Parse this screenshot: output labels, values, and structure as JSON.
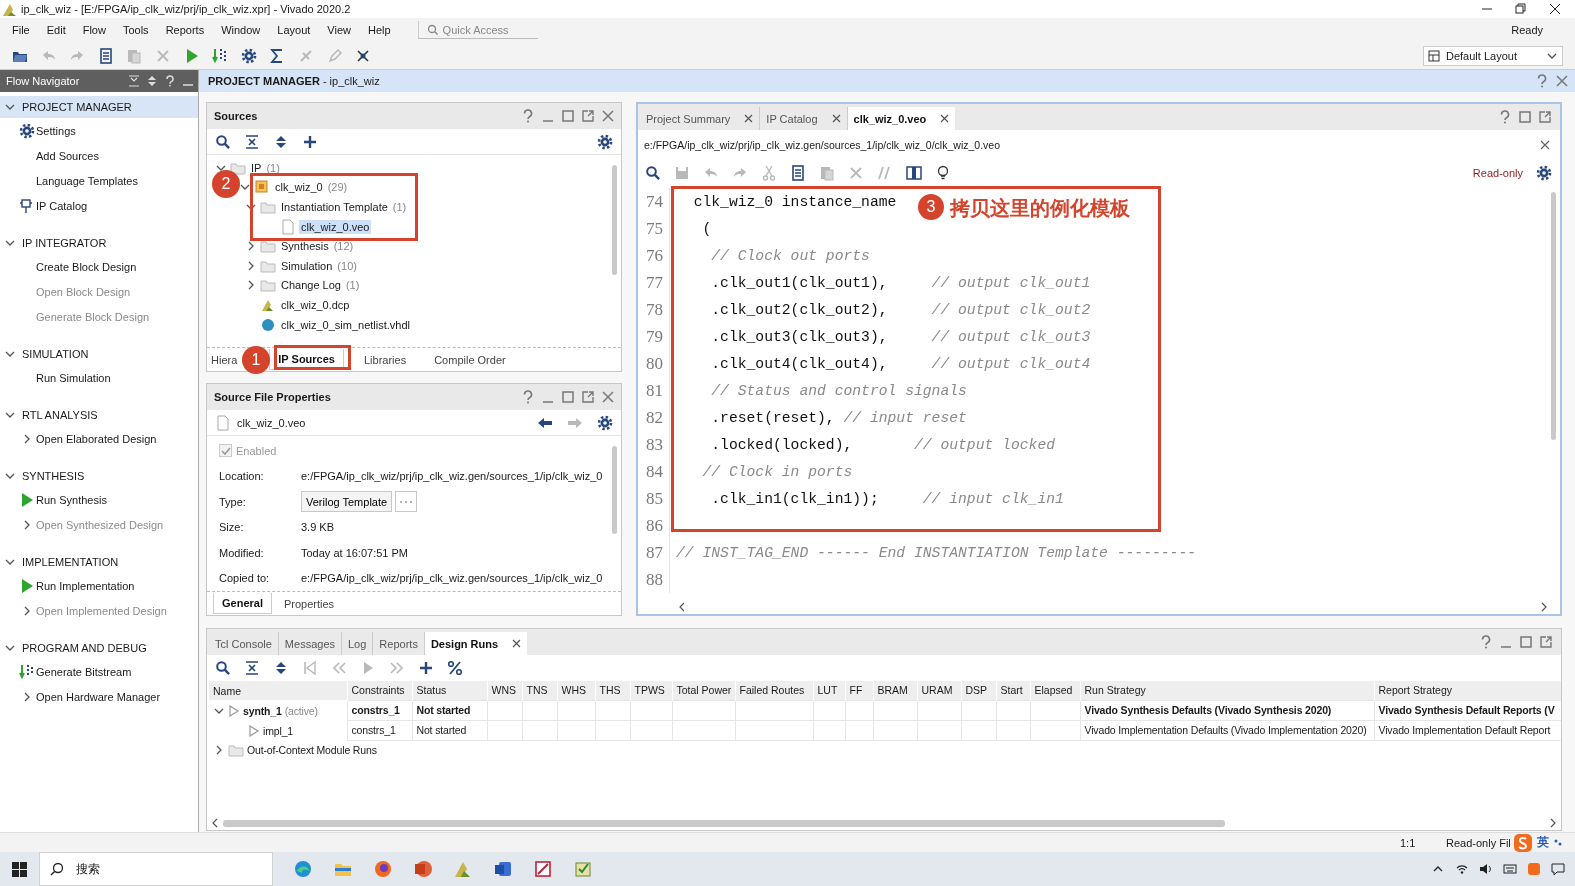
{
  "window": {
    "title": "ip_clk_wiz - [E:/FPGA/ip_clk_wiz/prj/ip_clk_wiz.xpr] - Vivado 2020.2"
  },
  "menu": [
    "File",
    "Edit",
    "Flow",
    "Tools",
    "Reports",
    "Window",
    "Layout",
    "View",
    "Help"
  ],
  "quick_access": {
    "placeholder": "Quick Access"
  },
  "status_text": "Ready",
  "layout_dropdown": {
    "value": "Default Layout"
  },
  "flow_navigator": {
    "title": "Flow Navigator",
    "sections": [
      {
        "title": "PROJECT MANAGER",
        "selected": true,
        "expanded": true,
        "items": [
          {
            "label": "Settings",
            "kind": "gear",
            "disabled": false
          },
          {
            "label": "Add Sources",
            "kind": "plain",
            "disabled": false
          },
          {
            "label": "Language Templates",
            "kind": "plain",
            "disabled": false
          },
          {
            "label": "IP Catalog",
            "kind": "ip",
            "disabled": false
          }
        ]
      },
      {
        "title": "IP INTEGRATOR",
        "selected": false,
        "expanded": true,
        "items": [
          {
            "label": "Create Block Design",
            "kind": "plain",
            "disabled": false
          },
          {
            "label": "Open Block Design",
            "kind": "plain",
            "disabled": true
          },
          {
            "label": "Generate Block Design",
            "kind": "plain",
            "disabled": true
          }
        ]
      },
      {
        "title": "SIMULATION",
        "selected": false,
        "expanded": true,
        "items": [
          {
            "label": "Run Simulation",
            "kind": "plain",
            "disabled": false
          }
        ]
      },
      {
        "title": "RTL ANALYSIS",
        "selected": false,
        "expanded": true,
        "items": [
          {
            "label": "Open Elaborated Design",
            "kind": "expand",
            "disabled": false
          }
        ]
      },
      {
        "title": "SYNTHESIS",
        "selected": false,
        "expanded": true,
        "items": [
          {
            "label": "Run Synthesis",
            "kind": "run",
            "disabled": false
          },
          {
            "label": "Open Synthesized Design",
            "kind": "expand",
            "disabled": true
          }
        ]
      },
      {
        "title": "IMPLEMENTATION",
        "selected": false,
        "expanded": true,
        "items": [
          {
            "label": "Run Implementation",
            "kind": "run",
            "disabled": false
          },
          {
            "label": "Open Implemented Design",
            "kind": "expand",
            "disabled": true
          }
        ]
      },
      {
        "title": "PROGRAM AND DEBUG",
        "selected": false,
        "expanded": true,
        "items": [
          {
            "label": "Generate Bitstream",
            "kind": "bitstream",
            "disabled": false
          },
          {
            "label": "Open Hardware Manager",
            "kind": "expand",
            "disabled": false
          }
        ]
      }
    ]
  },
  "project_bar": {
    "title": "**PROJECT MANAGER** - ip_clk_wiz"
  },
  "sources": {
    "title": "Sources",
    "tree": [
      {
        "label": "IP",
        "count": "(1)",
        "kind": "folder",
        "expanded": true,
        "selected": false,
        "children": [
          {
            "label": "clk_wiz_0",
            "count": "(29)",
            "kind": "ip",
            "expanded": true,
            "selected": false,
            "children": [
              {
                "label": "Instantiation Template",
                "count": "(1)",
                "kind": "folder",
                "expanded": true,
                "selected": false,
                "children": [
                  {
                    "label": "clk_wiz_0.veo",
                    "kind": "file",
                    "selected": true
                  }
                ]
              },
              {
                "label": "Synthesis",
                "count": "(12)",
                "kind": "folder",
                "expanded": false,
                "selected": false
              },
              {
                "label": "Simulation",
                "count": "(10)",
                "kind": "folder",
                "expanded": false,
                "selected": false
              },
              {
                "label": "Change Log",
                "count": "(1)",
                "kind": "folder",
                "expanded": false,
                "selected": false
              },
              {
                "label": "clk_wiz_0.dcp",
                "kind": "dcp",
                "selected": false
              },
              {
                "label": "clk_wiz_0_sim_netlist.vhdl",
                "kind": "sim",
                "selected": false
              }
            ]
          }
        ]
      }
    ],
    "tabs": [
      {
        "label": "Hiera",
        "selected": false
      },
      {
        "label": "IP Sources",
        "selected": true
      },
      {
        "label": "Libraries",
        "selected": false
      },
      {
        "label": "Compile Order",
        "selected": false
      }
    ]
  },
  "properties": {
    "title": "Source File Properties",
    "file": "clk_wiz_0.veo",
    "enabled": {
      "label": "Enabled",
      "checked": true,
      "disabled": true
    },
    "fields": [
      {
        "label": "Location:",
        "value": "e:/FPGA/ip_clk_wiz/prj/ip_clk_wiz.gen/sources_1/ip/clk_wiz_0",
        "kind": "text"
      },
      {
        "label": "Type:",
        "value": "Verilog Template",
        "kind": "button"
      },
      {
        "label": "Size:",
        "value": "3.9 KB",
        "kind": "text"
      },
      {
        "label": "Modified:",
        "value": "Today at 16:07:51 PM",
        "kind": "text"
      },
      {
        "label": "Copied to:",
        "value": "e:/FPGA/ip_clk_wiz/prj/ip_clk_wiz.gen/sources_1/ip/clk_wiz_0",
        "kind": "text"
      }
    ],
    "tabs": [
      {
        "label": "General",
        "selected": true
      },
      {
        "label": "Properties",
        "selected": false
      }
    ]
  },
  "editor": {
    "tabs": [
      {
        "label": "Project Summary",
        "selected": false
      },
      {
        "label": "IP Catalog",
        "selected": false
      },
      {
        "label": "clk_wiz_0.veo",
        "selected": true
      }
    ],
    "path": "e:/FPGA/ip_clk_wiz/prj/ip_clk_wiz.gen/sources_1/ip/clk_wiz_0/clk_wiz_0.veo",
    "mode": "Read-only",
    "lines": [
      {
        "number": "74",
        "code": "  clk_wiz_0 instance_name"
      },
      {
        "number": "75",
        "code": "   ("
      },
      {
        "number": "76",
        "comment": "    // Clock out ports"
      },
      {
        "number": "77",
        "code": "    .clk_out1(clk_out1),     ",
        "comment": "// output clk_out1"
      },
      {
        "number": "78",
        "code": "    .clk_out2(clk_out2),     ",
        "comment": "// output clk_out2"
      },
      {
        "number": "79",
        "code": "    .clk_out3(clk_out3),     ",
        "comment": "// output clk_out3"
      },
      {
        "number": "80",
        "code": "    .clk_out4(clk_out4),     ",
        "comment": "// output clk_out4"
      },
      {
        "number": "81",
        "comment": "    // Status and control signals"
      },
      {
        "number": "82",
        "code": "    .reset(reset), ",
        "comment": "// input reset"
      },
      {
        "number": "83",
        "code": "    .locked(locked),       ",
        "comment": "// output locked"
      },
      {
        "number": "84",
        "comment": "   // Clock in ports"
      },
      {
        "number": "85",
        "code": "    .clk_in1(clk_in1));     ",
        "comment": "// input clk_in1"
      },
      {
        "number": "86"
      },
      {
        "number": "87",
        "comment": "// INST_TAG_END ------ End INSTANTIATION Template ---------"
      },
      {
        "number": "88"
      }
    ]
  },
  "annotations": [
    {
      "number": "1"
    },
    {
      "number": "2"
    },
    {
      "number": "3",
      "text": "拷贝这里的例化模板"
    }
  ],
  "runs": {
    "tabs": [
      {
        "label": "Tcl Console",
        "selected": false
      },
      {
        "label": "Messages",
        "selected": false
      },
      {
        "label": "Log",
        "selected": false
      },
      {
        "label": "Reports",
        "selected": false
      },
      {
        "label": "Design Runs",
        "selected": true
      }
    ],
    "columns": [
      "Name",
      "Constraints",
      "Status",
      "WNS",
      "TNS",
      "WHS",
      "THS",
      "TPWS",
      "Total Power",
      "Failed Routes",
      "LUT",
      "FF",
      "BRAM",
      "URAM",
      "DSP",
      "Start",
      "Elapsed",
      "Run Strategy",
      "Report Strategy"
    ],
    "rows": [
      {
        "name": "synth_1",
        "note": "(active)",
        "kind": "run",
        "active": true,
        "expanded": true,
        "constraints": "constrs_1",
        "status": "Not started",
        "run_strategy": "Vivado Synthesis Defaults (Vivado Synthesis 2020)",
        "report_strategy": "Vivado Synthesis Default Reports (V",
        "children": [
          {
            "name": "impl_1",
            "kind": "run",
            "active": false,
            "constraints": "constrs_1",
            "status": "Not started",
            "run_strategy": "Vivado Implementation Defaults (Vivado Implementation 2020)",
            "report_strategy": "Vivado Implementation Default Report"
          }
        ]
      },
      {
        "name": "Out-of-Context Module Runs",
        "kind": "folder",
        "active": false,
        "expanded": false
      }
    ]
  },
  "status_bar": {
    "position": "1:1",
    "mode": "Read-only Fil",
    "ime": "英"
  },
  "taskbar": {
    "search": {
      "placeholder": "搜索"
    }
  }
}
